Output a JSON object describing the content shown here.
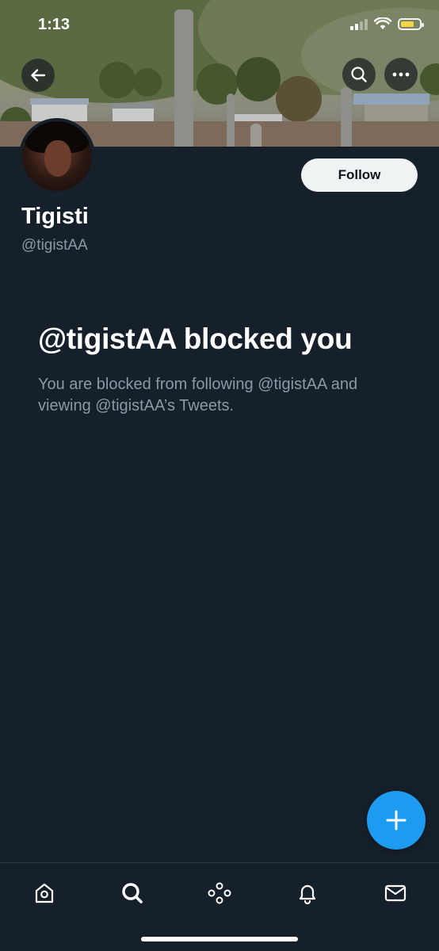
{
  "status_bar": {
    "time": "1:13"
  },
  "profile": {
    "display_name": "Tigisti",
    "handle": "@tigistAA",
    "follow_label": "Follow"
  },
  "blocked_notice": {
    "title": "@tigistAA blocked you",
    "description": "You are blocked from following @tigistAA and viewing @tigistAA’s Tweets."
  },
  "icons": {
    "back": "back-arrow-icon",
    "search": "search-icon",
    "more": "more-icon",
    "compose": "plus-icon",
    "nav": [
      "home-icon",
      "search-icon",
      "spaces-icon",
      "bell-icon",
      "mail-icon"
    ]
  },
  "colors": {
    "background": "#16202b",
    "accent": "#1d9bf0",
    "secondary_text": "#8b98a5",
    "follow_button": "#eff3f4"
  }
}
